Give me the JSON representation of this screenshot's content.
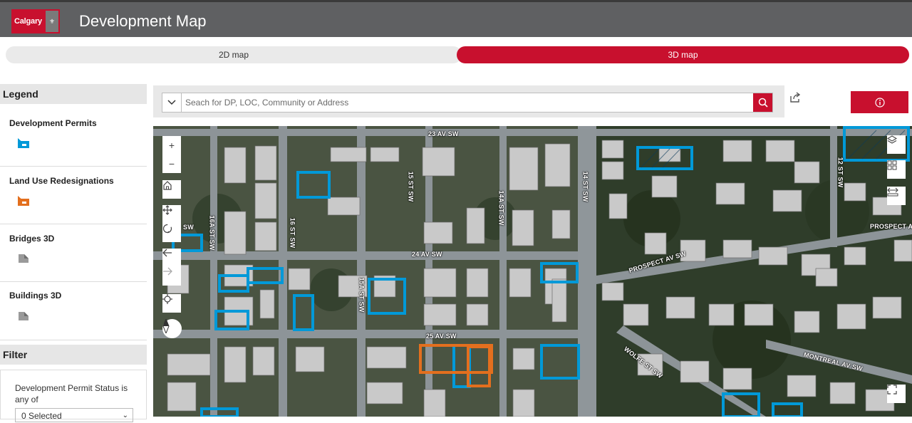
{
  "header": {
    "logo_text": "Calgary",
    "title": "Development Map"
  },
  "view_toggle": {
    "option_2d": "2D map",
    "option_3d": "3D map",
    "active": "3D map"
  },
  "legend": {
    "heading": "Legend",
    "items": [
      {
        "label": "Development Permits",
        "color": "#0099d8",
        "icon": "development-permit-symbol"
      },
      {
        "label": "Land Use Redesignations",
        "color": "#e36f1e",
        "icon": "land-use-symbol"
      },
      {
        "label": "Bridges 3D",
        "color": "#8a8a8a",
        "icon": "bridge-3d-symbol"
      },
      {
        "label": "Buildings 3D",
        "color": "#8a8a8a",
        "icon": "building-3d-symbol"
      }
    ]
  },
  "filter": {
    "heading": "Filter",
    "permit_status_label": "Development Permit Status is any of",
    "permit_status_value": "0 Selected"
  },
  "search": {
    "placeholder": "Seach for DP, LOC, Community or Address",
    "value": ""
  },
  "map": {
    "streets": [
      "23 AV SW",
      "24 AV SW",
      "25 AV SW",
      "15 ST SW",
      "14A ST SW",
      "14 ST SW",
      "16A ST SW",
      "16 ST SW",
      "15A ST SW",
      "PROSPECT AV SW",
      "PROSPECT AV",
      "WOLFE ST SW",
      "MONTREAL AV SW",
      "12 ST SW",
      "SW"
    ]
  },
  "colors": {
    "brand_red": "#c8102e",
    "header_gray": "#5f6062",
    "permit_blue": "#0099d8",
    "land_use_orange": "#e36f1e"
  }
}
